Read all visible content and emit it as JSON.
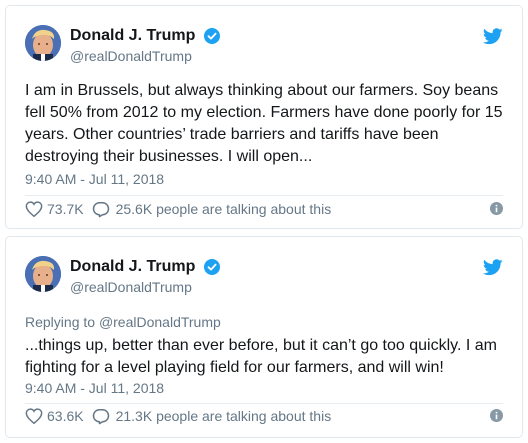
{
  "colors": {
    "twitter_blue": "#1da1f2",
    "text_primary": "#14171a",
    "text_secondary": "#657786",
    "border": "#e1e8ed"
  },
  "icons": {
    "bird": "twitter-bird-icon",
    "verified": "verified-badge-icon",
    "like": "heart-icon",
    "reply": "comment-bubble-icon",
    "info": "info-icon"
  },
  "tweets": [
    {
      "display_name": "Donald J. Trump",
      "handle": "@realDonaldTrump",
      "replying_to": "",
      "text": "I am in Brussels, but always thinking about our farmers. Soy beans fell 50% from 2012 to my election. Farmers have done poorly for 15 years. Other countries’ trade barriers and tariffs have been destroying their businesses. I will open...",
      "timestamp": "9:40 AM - Jul 11, 2018",
      "likes": "73.7K",
      "talking": "25.6K people are talking about this"
    },
    {
      "display_name": "Donald J. Trump",
      "handle": "@realDonaldTrump",
      "replying_to_label": "Replying to",
      "replying_to": "@realDonaldTrump",
      "text": "...things up, better than ever before, but it can’t go too quickly. I am fighting for a level playing field for our farmers, and will win!",
      "timestamp": "9:40 AM - Jul 11, 2018",
      "likes": "63.6K",
      "talking": "21.3K people are talking about this"
    }
  ]
}
